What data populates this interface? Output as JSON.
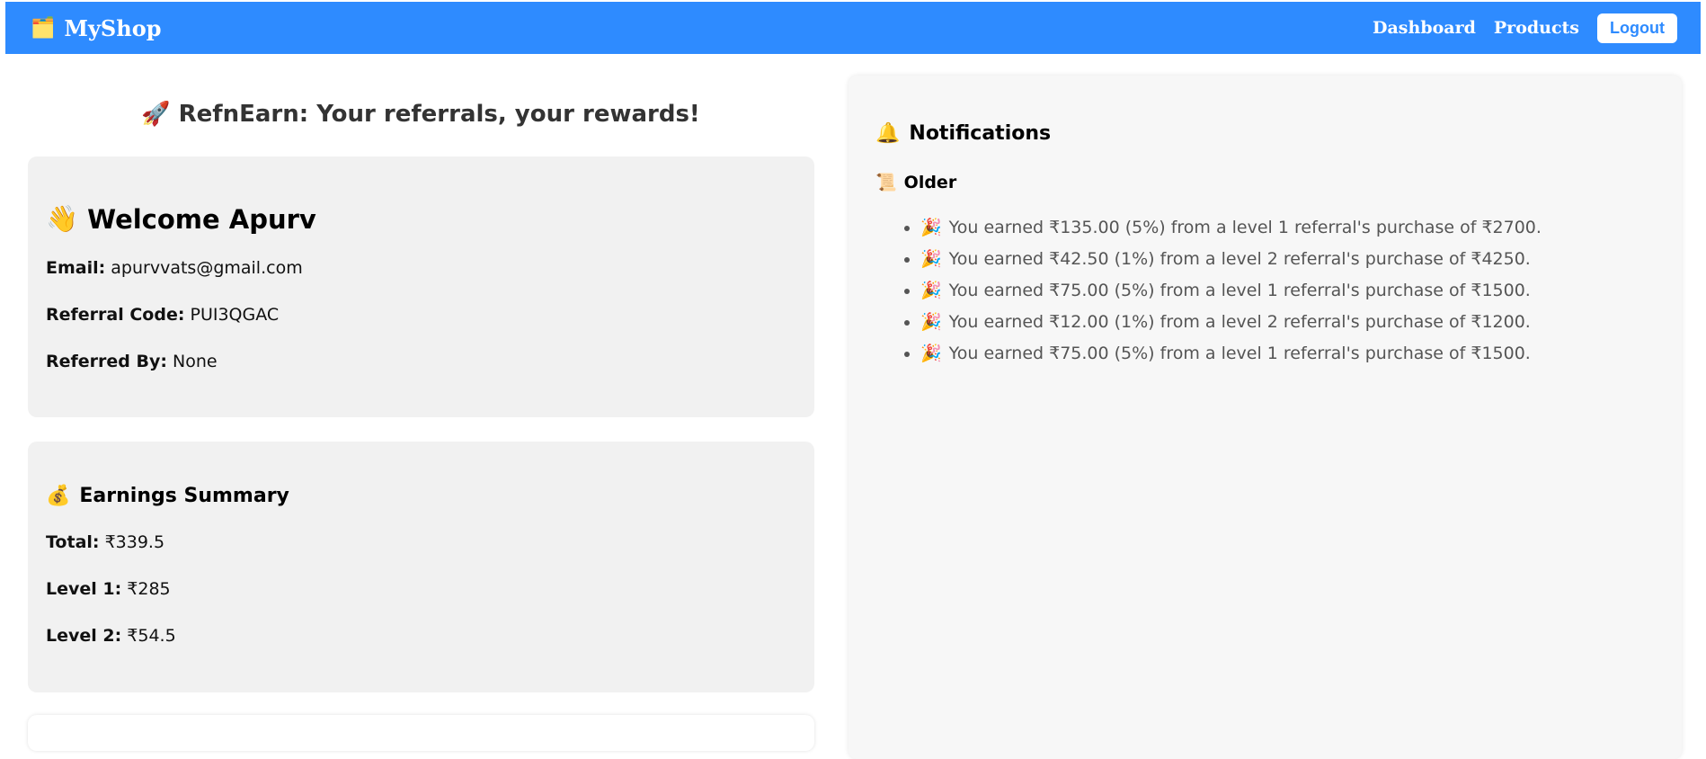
{
  "navbar": {
    "brand_icon": "🗂️",
    "brand_name": "MyShop",
    "links": {
      "dashboard": "Dashboard",
      "products": "Products"
    },
    "logout_label": "Logout"
  },
  "page_title": "🚀 RefnEarn: Your referrals, your rewards!",
  "welcome": {
    "icon": "👋",
    "heading": "Welcome Apurv",
    "email_label": "Email:",
    "email_value": "apurvvats@gmail.com",
    "referral_label": "Referral Code:",
    "referral_value": "PUI3QGAC",
    "referred_label": "Referred By:",
    "referred_value": "None"
  },
  "earnings": {
    "icon": "💰",
    "heading": "Earnings Summary",
    "total_label": "Total:",
    "total_value": "₹339.5",
    "level1_label": "Level 1:",
    "level1_value": "₹285",
    "level2_label": "Level 2:",
    "level2_value": "₹54.5"
  },
  "notifications": {
    "icon": "🔔",
    "heading": "Notifications",
    "older_icon": "📜",
    "older_heading": "Older",
    "item_icon": "🎉",
    "items": [
      "You earned ₹135.00 (5%) from a level 1 referral's purchase of ₹2700.",
      "You earned ₹42.50 (1%) from a level 2 referral's purchase of ₹4250.",
      "You earned ₹75.00 (5%) from a level 1 referral's purchase of ₹1500.",
      "You earned ₹12.00 (1%) from a level 2 referral's purchase of ₹1200.",
      "You earned ₹75.00 (5%) from a level 1 referral's purchase of ₹1500."
    ]
  },
  "colors": {
    "navbar": "#2e8bff",
    "card": "#f1f1f1",
    "panel": "#f7f7f7"
  }
}
